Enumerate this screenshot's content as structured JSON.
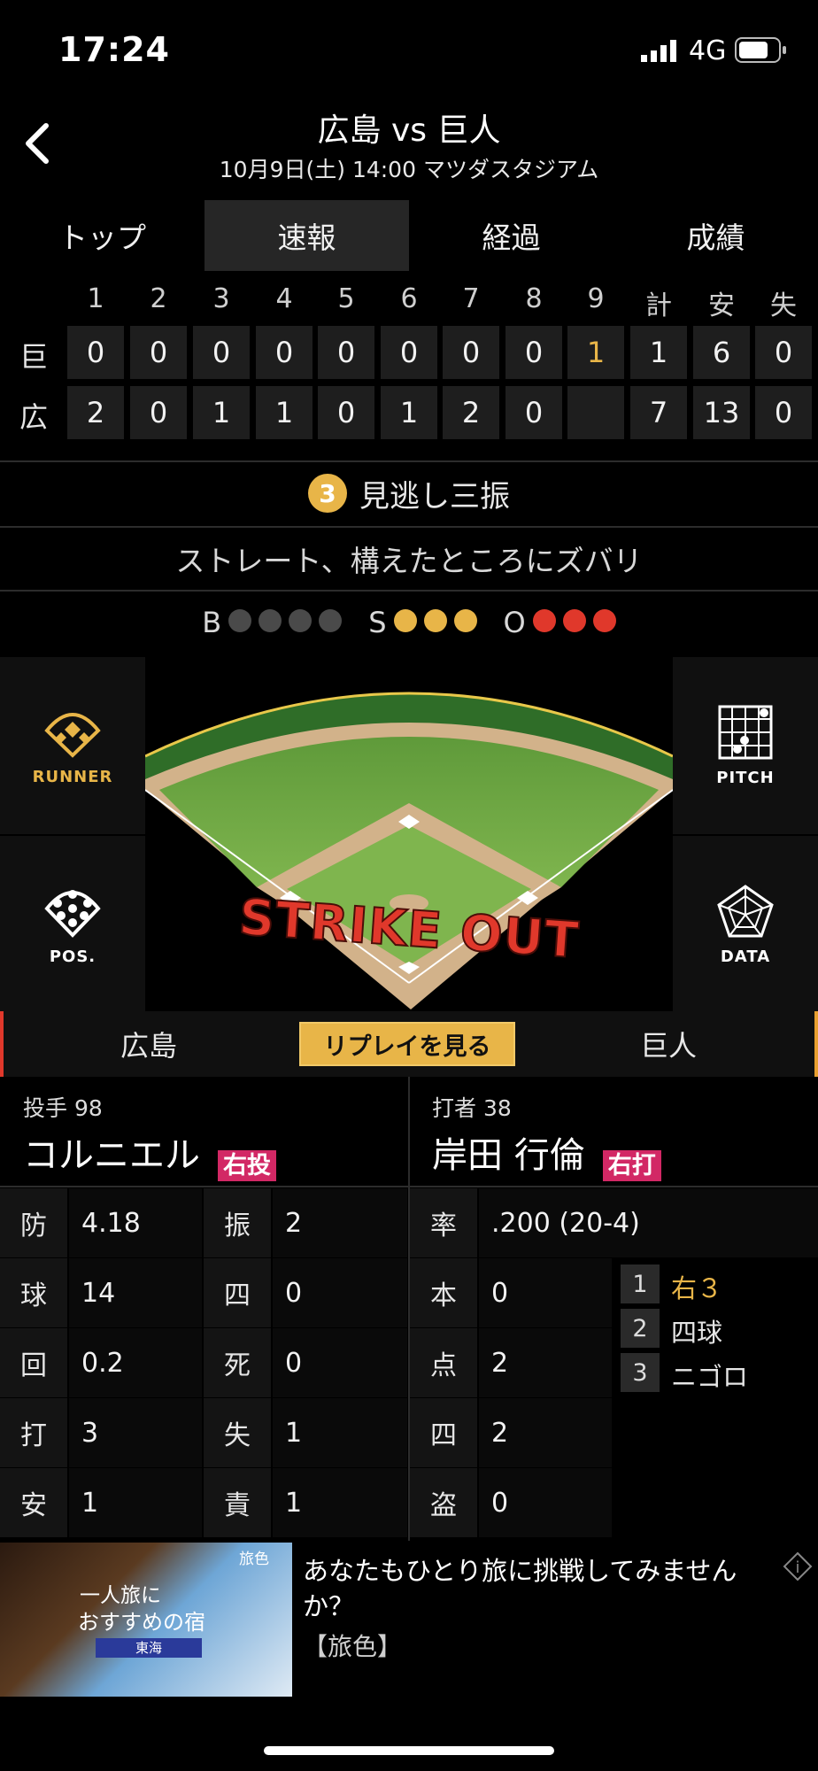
{
  "status": {
    "time": "17:24",
    "network": "4G"
  },
  "header": {
    "title": "広島 vs 巨人",
    "subtitle": "10月9日(土) 14:00 マツダスタジアム"
  },
  "tabs": [
    "トップ",
    "速報",
    "経過",
    "成績"
  ],
  "scoreboard": {
    "headers": [
      "1",
      "2",
      "3",
      "4",
      "5",
      "6",
      "7",
      "8",
      "9",
      "計",
      "安",
      "失"
    ],
    "rows": [
      {
        "team": "巨",
        "cells": [
          "0",
          "0",
          "0",
          "0",
          "0",
          "0",
          "0",
          "0",
          "1",
          "1",
          "6",
          "0"
        ]
      },
      {
        "team": "広",
        "cells": [
          "2",
          "0",
          "1",
          "1",
          "0",
          "1",
          "2",
          "0",
          "",
          "7",
          "13",
          "0"
        ]
      }
    ],
    "highlight_color": "#e8b548"
  },
  "play": {
    "number": "3",
    "result": "見逃し三振",
    "description": "ストレート、構えたところにズバリ"
  },
  "count": {
    "b_label": "B",
    "s_label": "S",
    "o_label": "O",
    "balls": 0,
    "strikes": 3,
    "outs": 3
  },
  "field": {
    "overlay_text": "STRIKE OUT"
  },
  "side_buttons": {
    "runner": "RUNNER",
    "pitch": "PITCH",
    "pos": "POS.",
    "data": "DATA"
  },
  "teambar": {
    "left_team": "広島",
    "replay_label": "リプレイを見る",
    "right_team": "巨人"
  },
  "pitcher": {
    "role": "投手 98",
    "name": "コルニエル",
    "hand": "右投"
  },
  "batter": {
    "role": "打者 38",
    "name": "岸田 行倫",
    "hand": "右打"
  },
  "pitcher_stats": [
    {
      "l1": "防",
      "v1": "4.18",
      "l2": "振",
      "v2": "2"
    },
    {
      "l1": "球",
      "v1": "14",
      "l2": "四",
      "v2": "0"
    },
    {
      "l1": "回",
      "v1": "0.2",
      "l2": "死",
      "v2": "0"
    },
    {
      "l1": "打",
      "v1": "3",
      "l2": "失",
      "v2": "1"
    },
    {
      "l1": "安",
      "v1": "1",
      "l2": "責",
      "v2": "1"
    }
  ],
  "batter_stats": [
    {
      "l": "率",
      "v": ".200 (20-4)"
    },
    {
      "l": "本",
      "v": "0"
    },
    {
      "l": "点",
      "v": "2"
    },
    {
      "l": "四",
      "v": "2"
    },
    {
      "l": "盗",
      "v": "0"
    }
  ],
  "batter_history": [
    {
      "n": "1",
      "t": "右３"
    },
    {
      "n": "2",
      "t": "四球"
    },
    {
      "n": "3",
      "t": "ニゴロ"
    }
  ],
  "ad": {
    "img_tag": "旅色",
    "img_line1": "一人旅に",
    "img_line2": "おすすめの宿",
    "img_line3": "東海",
    "title": "あなたもひとり旅に挑戦してみませんか？",
    "source": "【旅色】"
  }
}
